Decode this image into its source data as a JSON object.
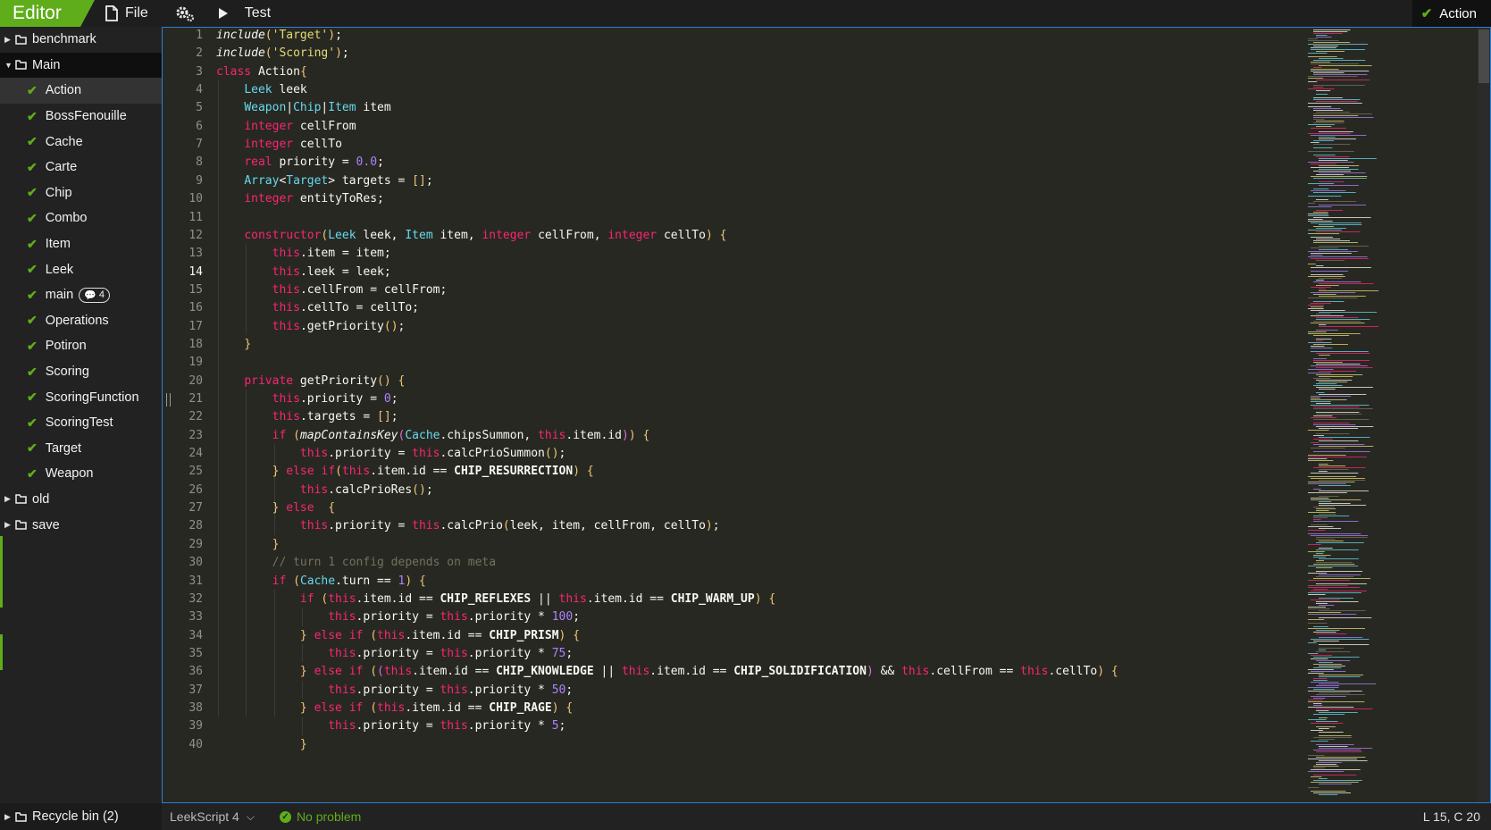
{
  "topbar": {
    "brand": "Editor",
    "file_label": "File",
    "test_label": "Test",
    "active_file": "Action"
  },
  "sidebar": {
    "folders_top": [
      {
        "label": "benchmark",
        "open": false
      },
      {
        "label": "Main",
        "open": true
      }
    ],
    "files": [
      {
        "label": "Action",
        "selected": true
      },
      {
        "label": "BossFenouille"
      },
      {
        "label": "Cache"
      },
      {
        "label": "Carte"
      },
      {
        "label": "Chip"
      },
      {
        "label": "Combo"
      },
      {
        "label": "Item"
      },
      {
        "label": "Leek"
      },
      {
        "label": "main",
        "badge": "4"
      },
      {
        "label": "Operations"
      },
      {
        "label": "Potiron"
      },
      {
        "label": "Scoring"
      },
      {
        "label": "ScoringFunction"
      },
      {
        "label": "ScoringTest"
      },
      {
        "label": "Target"
      },
      {
        "label": "Weapon"
      }
    ],
    "folders_bottom": [
      {
        "label": "old"
      },
      {
        "label": "save"
      }
    ],
    "recycle_bin": "Recycle bin (2)"
  },
  "editor": {
    "current_line": 14,
    "lines": [
      "include('Target');",
      "include('Scoring');",
      "class Action{",
      "    Leek leek",
      "    Weapon|Chip|Item item",
      "    integer cellFrom",
      "    integer cellTo",
      "    real priority = 0.0;",
      "    Array<Target> targets = [];",
      "    integer entityToRes;",
      "",
      "    constructor(Leek leek, Item item, integer cellFrom, integer cellTo) {",
      "        this.item = item;",
      "        this.leek = leek;",
      "        this.cellFrom = cellFrom;",
      "        this.cellTo = cellTo;",
      "        this.getPriority();",
      "    }",
      "",
      "    private getPriority() {",
      "        this.priority = 0;",
      "        this.targets = [];",
      "        if (mapContainsKey(Cache.chipsSummon, this.item.id)) {",
      "            this.priority = this.calcPrioSummon();",
      "        } else if(this.item.id == CHIP_RESURRECTION) {",
      "            this.calcPrioRes();",
      "        } else  {",
      "            this.priority = this.calcPrio(leek, item, cellFrom, cellTo);",
      "        }",
      "        // turn 1 config depends on meta",
      "        if (Cache.turn == 1) {",
      "            if (this.item.id == CHIP_REFLEXES || this.item.id == CHIP_WARM_UP) {",
      "                this.priority = this.priority * 100;",
      "            } else if (this.item.id == CHIP_PRISM) {",
      "                this.priority = this.priority * 75;",
      "            } else if ((this.item.id == CHIP_KNOWLEDGE || this.item.id == CHIP_SOLIDIFICATION) && this.cellFrom == this.cellTo) {",
      "                this.priority = this.priority * 50;",
      "            } else if (this.item.id == CHIP_RAGE) {",
      "                this.priority = this.priority * 5;",
      "            }"
    ]
  },
  "statusbar": {
    "language": "LeekScript 4",
    "problems": "No problem",
    "cursor": "L 15, C 20"
  }
}
